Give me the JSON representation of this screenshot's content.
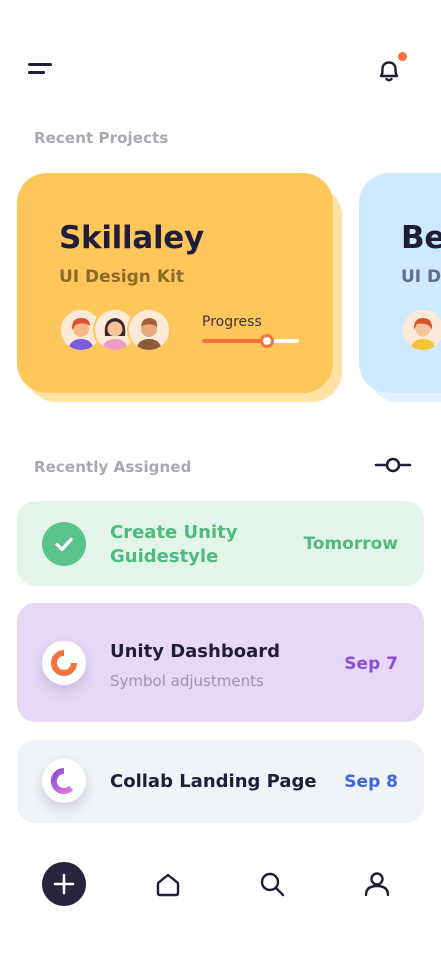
{
  "sections": {
    "recent_projects": "Recent Projects",
    "recently_assigned": "Recently Assigned"
  },
  "projects": [
    {
      "title": "Skillaley",
      "subtitle": "UI Design Kit",
      "progress_label": "Progress",
      "progress": 0.67,
      "color": "#ffc75b"
    },
    {
      "title": "Be",
      "subtitle": "UI De",
      "color": "#cfe9fe"
    }
  ],
  "tasks": [
    {
      "title": "Create Unity Guidestyle",
      "date": "Tomorrow",
      "status": "completed",
      "color": "#e3f5eb"
    },
    {
      "title": "Unity Dashboard",
      "subtitle": "Symbol adjustments",
      "date": "Sep 7",
      "color": "#e7d8f8"
    },
    {
      "title": "Collab Landing Page",
      "date": "Sep 8",
      "color": "#f0f3f7"
    }
  ],
  "icons": {
    "menu": "menu-icon",
    "notifications": "bell-icon",
    "filter": "filter-icon",
    "add": "plus-icon",
    "home": "home-icon",
    "search": "search-icon",
    "profile": "user-icon"
  },
  "colors": {
    "accent_orange": "#f4733c",
    "dark": "#1f1d3a",
    "green": "#4fba7c",
    "purple": "#8a4fd6",
    "blue": "#3d64db"
  }
}
